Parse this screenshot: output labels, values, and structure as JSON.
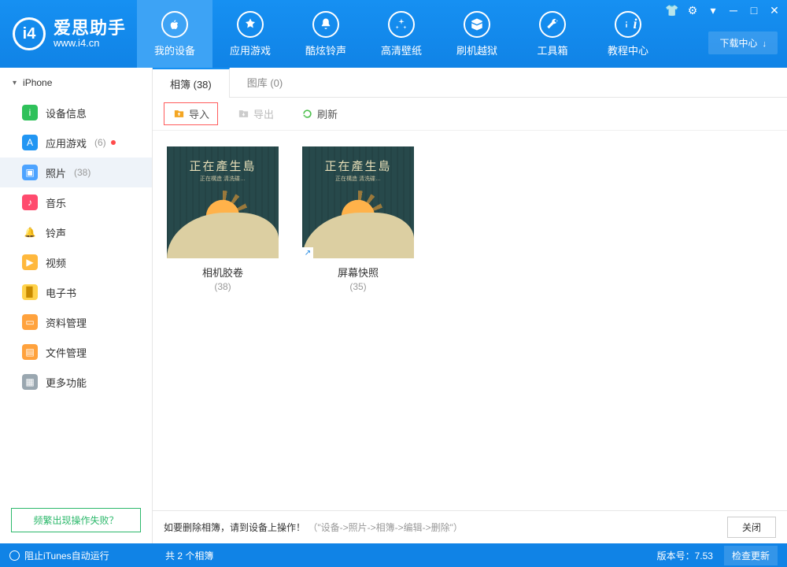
{
  "app": {
    "title": "爱思助手",
    "url": "www.i4.cn"
  },
  "nav": [
    {
      "label": "我的设备"
    },
    {
      "label": "应用游戏"
    },
    {
      "label": "酷炫铃声"
    },
    {
      "label": "高清壁纸"
    },
    {
      "label": "刷机越狱"
    },
    {
      "label": "工具箱"
    },
    {
      "label": "教程中心"
    }
  ],
  "download_center": "下载中心",
  "device_name": "iPhone",
  "sidebar": [
    {
      "label": "设备信息",
      "count": ""
    },
    {
      "label": "应用游戏",
      "count": "(6)",
      "dot": true
    },
    {
      "label": "照片",
      "count": "(38)"
    },
    {
      "label": "音乐",
      "count": ""
    },
    {
      "label": "铃声",
      "count": ""
    },
    {
      "label": "视频",
      "count": ""
    },
    {
      "label": "电子书",
      "count": ""
    },
    {
      "label": "资料管理",
      "count": ""
    },
    {
      "label": "文件管理",
      "count": ""
    },
    {
      "label": "更多功能",
      "count": ""
    }
  ],
  "side_help": "频繁出现操作失败？",
  "tabs": [
    {
      "label": "相簿 (38)"
    },
    {
      "label": "图库 (0)"
    }
  ],
  "toolbar": {
    "import": "导入",
    "export": "导出",
    "refresh": "刷新"
  },
  "albums": [
    {
      "name": "相机胶卷",
      "count": "(38)",
      "art_top": "正在產生島",
      "art_sub": "正在構造 清洗碟…"
    },
    {
      "name": "屏幕快照",
      "count": "(35)",
      "art_top": "正在產生島",
      "art_sub": "正在構造 清洗碟…",
      "corner": "↗"
    }
  ],
  "hint": {
    "text": "如要删除相簿，请到设备上操作！",
    "path": "（\"设备->照片->相簿->编辑->删除\"）",
    "close": "关闭"
  },
  "footer": {
    "itunes": "阻止iTunes自动运行",
    "summary": "共 2 个相簿",
    "version_label": "版本号：",
    "version": "7.53",
    "update": "检查更新"
  }
}
